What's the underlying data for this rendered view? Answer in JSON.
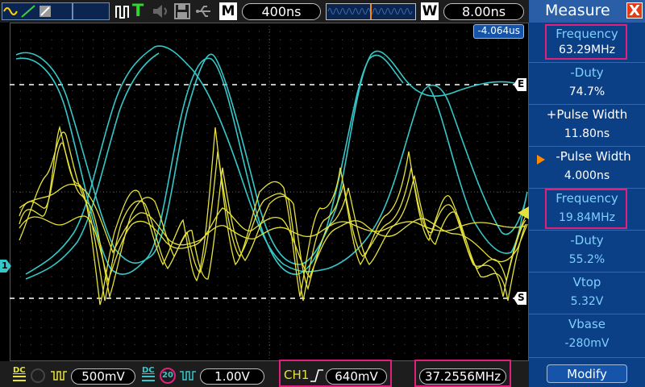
{
  "top_bar": {
    "mode_label": "M",
    "timebase_delay": "400ns",
    "window_label": "W",
    "window_timebase": "8.00ns",
    "trigger_offset": "-4.064us",
    "trigger_letter": "T"
  },
  "markers": {
    "level_e": "E",
    "level_s": "S",
    "ch1_ground": "1"
  },
  "bottom_bar": {
    "ch1": {
      "coupling": "DC",
      "volts": "500mV"
    },
    "ch2": {
      "coupling": "DC",
      "bw_limit": "20",
      "volts": "1.00V"
    },
    "trigger": {
      "source": "CH1",
      "level": "640mV"
    },
    "counter": "37.2556MHz"
  },
  "measure_panel": {
    "title": "Measure",
    "close": "X",
    "items": [
      {
        "label": "Frequency",
        "value": "63.29MHz",
        "highlight": true
      },
      {
        "label": "-Duty",
        "value": "74.7%"
      },
      {
        "label": "+Pulse Width",
        "value": "11.80ns"
      },
      {
        "label": "-Pulse Width",
        "value": "4.000ns",
        "selected": true
      },
      {
        "label": "Frequency",
        "value": "19.84MHz",
        "highlight": true
      },
      {
        "label": "-Duty",
        "value": "55.2%"
      },
      {
        "label": "Vtop",
        "value": "5.32V"
      },
      {
        "label": "Vbase",
        "value": "-280mV"
      }
    ],
    "modify": "Modify"
  },
  "colors": {
    "ch1": "#e6e23a",
    "ch2": "#36c7c9",
    "panel_bg": "#0b3f86",
    "highlight": "#e0207a"
  }
}
